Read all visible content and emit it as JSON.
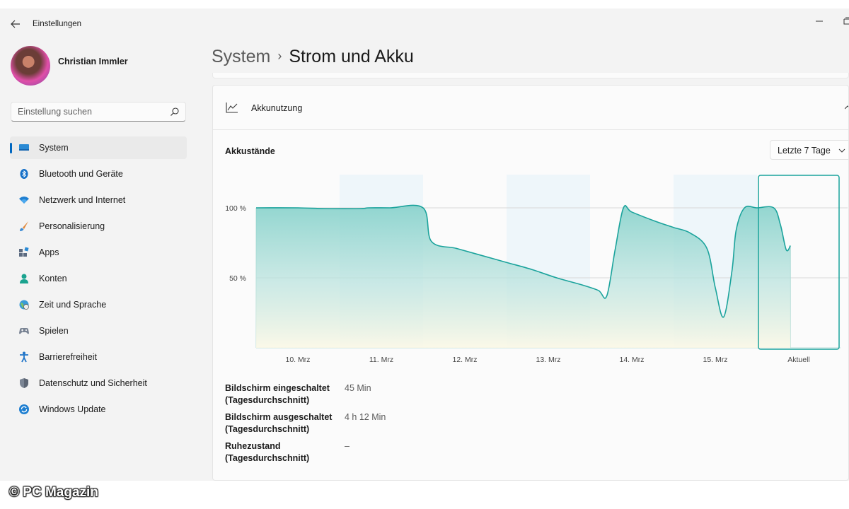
{
  "window": {
    "title": "Einstellungen"
  },
  "user": {
    "name": "Christian Immler"
  },
  "search": {
    "placeholder": "Einstellung suchen"
  },
  "nav": {
    "items": [
      {
        "label": "System",
        "icon": "monitor-icon",
        "active": true
      },
      {
        "label": "Bluetooth und Geräte",
        "icon": "bluetooth-icon"
      },
      {
        "label": "Netzwerk und Internet",
        "icon": "wifi-icon"
      },
      {
        "label": "Personalisierung",
        "icon": "brush-icon"
      },
      {
        "label": "Apps",
        "icon": "apps-icon"
      },
      {
        "label": "Konten",
        "icon": "person-icon"
      },
      {
        "label": "Zeit und Sprache",
        "icon": "globe-clock-icon"
      },
      {
        "label": "Spielen",
        "icon": "gamepad-icon"
      },
      {
        "label": "Barrierefreiheit",
        "icon": "accessibility-icon"
      },
      {
        "label": "Datenschutz und Sicherheit",
        "icon": "shield-icon"
      },
      {
        "label": "Windows Update",
        "icon": "update-icon"
      }
    ]
  },
  "breadcrumb": {
    "parent": "System",
    "separator": "›",
    "current": "Strom und Akku"
  },
  "card": {
    "title": "Akkunutzung",
    "subtitle": "Akkustände",
    "range": "Letzte 7 Tage"
  },
  "chart_data": {
    "type": "area",
    "x": [
      "10. Mrz",
      "11. Mrz",
      "12. Mrz",
      "13. Mrz",
      "14. Mrz",
      "15. Mrz",
      "Aktuell"
    ],
    "yticks": [
      "50 %",
      "100 %"
    ],
    "ylim": [
      0,
      100
    ],
    "grid": true,
    "line_color": "#1ba39c",
    "fill_top_color": "#7fcfc8",
    "fill_bottom_color": "#fbf8e6",
    "band_color": "#eef6fa",
    "highlight_category": "Aktuell",
    "points": [
      [
        0,
        100
      ],
      [
        0.5,
        100
      ],
      [
        0.82,
        99.5
      ],
      [
        1.25,
        99.5
      ],
      [
        1.35,
        100
      ],
      [
        1.6,
        100
      ],
      [
        2.0,
        100
      ],
      [
        2.1,
        76
      ],
      [
        2.4,
        71
      ],
      [
        2.7,
        66
      ],
      [
        3.0,
        61
      ],
      [
        3.3,
        56
      ],
      [
        3.6,
        50
      ],
      [
        3.9,
        45
      ],
      [
        4.1,
        41
      ],
      [
        4.2,
        37
      ],
      [
        4.3,
        70
      ],
      [
        4.4,
        100
      ],
      [
        4.5,
        97
      ],
      [
        4.8,
        90
      ],
      [
        5.0,
        86
      ],
      [
        5.2,
        82
      ],
      [
        5.4,
        71
      ],
      [
        5.5,
        43
      ],
      [
        5.6,
        22
      ],
      [
        5.7,
        55
      ],
      [
        5.75,
        84
      ],
      [
        5.85,
        100
      ],
      [
        6.0,
        100
      ],
      [
        6.2,
        100
      ],
      [
        6.28,
        88
      ],
      [
        6.35,
        70
      ],
      [
        6.4,
        73
      ]
    ]
  },
  "stats": [
    {
      "label": "Bildschirm eingeschaltet (Tagesdurchschnitt)",
      "value": "45 Min"
    },
    {
      "label": "Bildschirm ausgeschaltet (Tagesdurchschnitt)",
      "value": "4 h 12 Min"
    },
    {
      "label": "Ruhezustand (Tagesdurchschnitt)",
      "value": "–"
    }
  ],
  "watermark": "© PC Magazin"
}
